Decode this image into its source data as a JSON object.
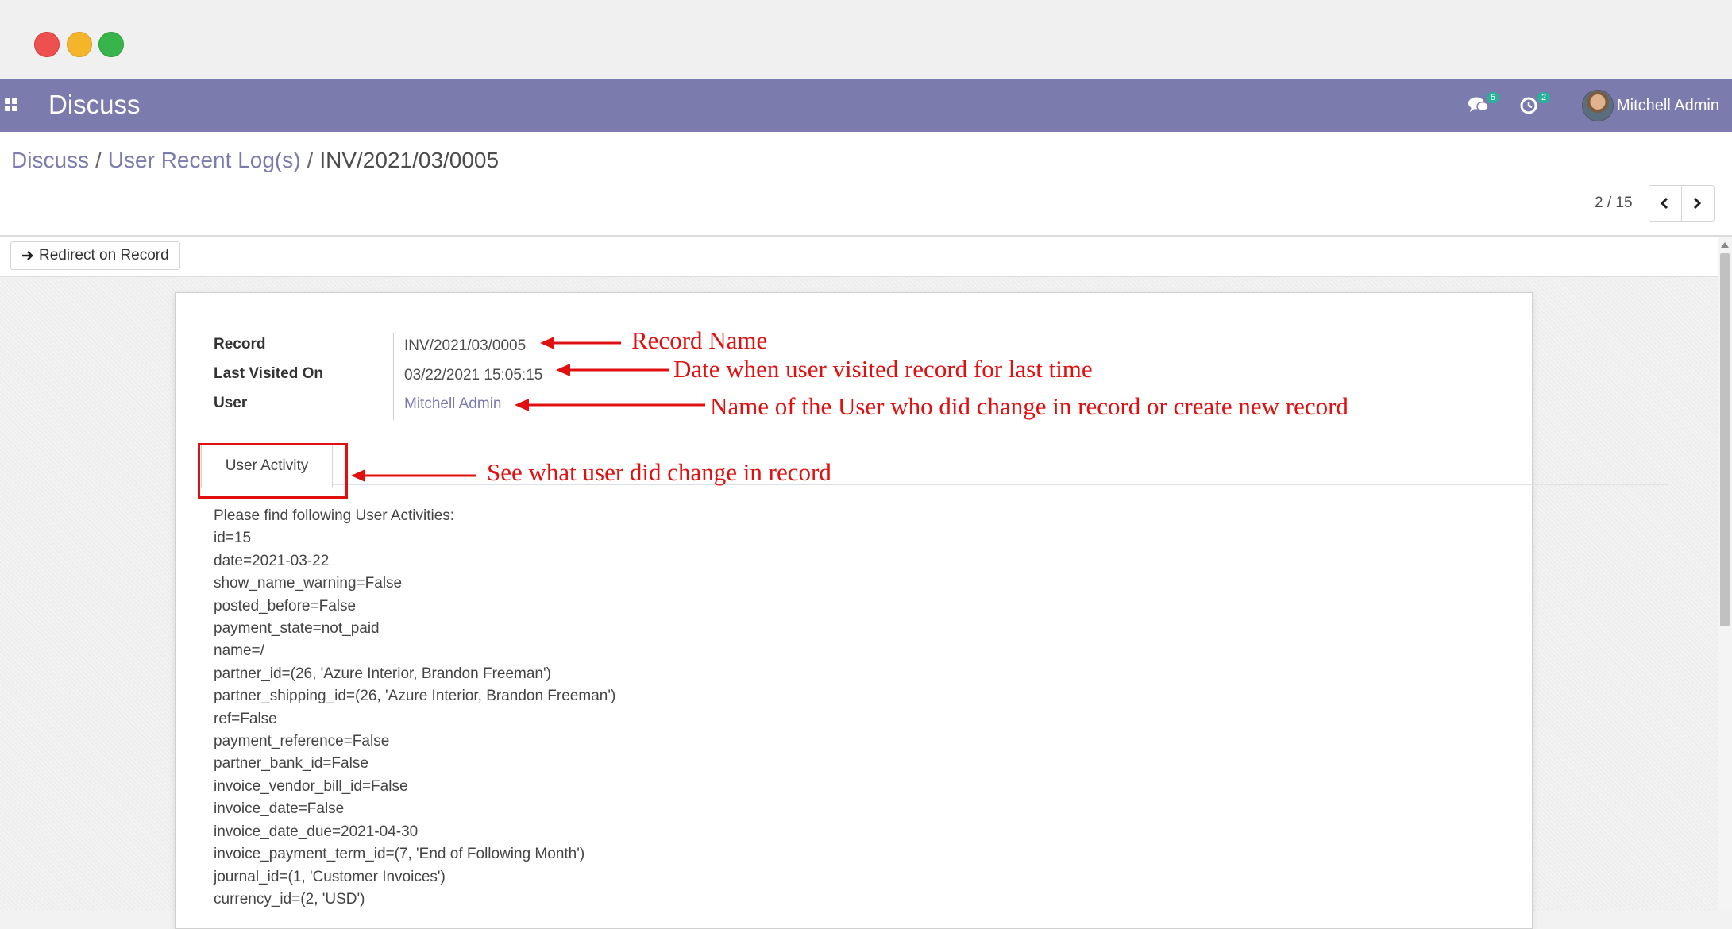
{
  "window": {
    "controls": [
      "close",
      "minimize",
      "maximize"
    ]
  },
  "navbar": {
    "apps_icon": "apps-grid-icon",
    "app_title": "Discuss",
    "messages_icon": "chat-bubbles-icon",
    "messages_count": "5",
    "activities_icon": "clock-icon",
    "activities_count": "2",
    "user_name": "Mitchell Admin",
    "bg_color": "#7c7bad"
  },
  "breadcrumb": {
    "items": [
      {
        "label": "Discuss"
      },
      {
        "label": "User Recent Log(s)"
      },
      {
        "label": "INV/2021/03/0005"
      }
    ],
    "separator": "/"
  },
  "pager": {
    "value": "2 / 15",
    "prev_icon": "chevron-left-icon",
    "next_icon": "chevron-right-icon"
  },
  "status_bar": {
    "redirect_button": {
      "icon": "arrow-right-icon",
      "label": "Redirect on Record"
    }
  },
  "form": {
    "fields": [
      {
        "label": "Record",
        "value": "INV/2021/03/0005"
      },
      {
        "label": "Last Visited On",
        "value": "03/22/2021 15:05:15"
      },
      {
        "label": "User",
        "value": "Mitchell Admin"
      }
    ],
    "tab_label": "User Activity",
    "activity_lines": [
      "Please find following User Activities:",
      "id=15",
      "date=2021-03-22",
      "show_name_warning=False",
      "posted_before=False",
      "payment_state=not_paid",
      "name=/",
      "partner_id=(26, 'Azure Interior, Brandon Freeman')",
      "partner_shipping_id=(26, 'Azure Interior, Brandon Freeman')",
      "ref=False",
      "payment_reference=False",
      "partner_bank_id=False",
      "invoice_vendor_bill_id=False",
      "invoice_date=False",
      "invoice_date_due=2021-04-30",
      "invoice_payment_term_id=(7, 'End of Following Month')",
      "journal_id=(1, 'Customer Invoices')",
      "currency_id=(2, 'USD')"
    ]
  },
  "annotations": {
    "record_name": "Record Name",
    "last_visited": "Date when user visited record for last time",
    "user": "Name of the User who did change in record or create new record",
    "user_activity": "See what user did change in record",
    "color": "#e01010"
  }
}
